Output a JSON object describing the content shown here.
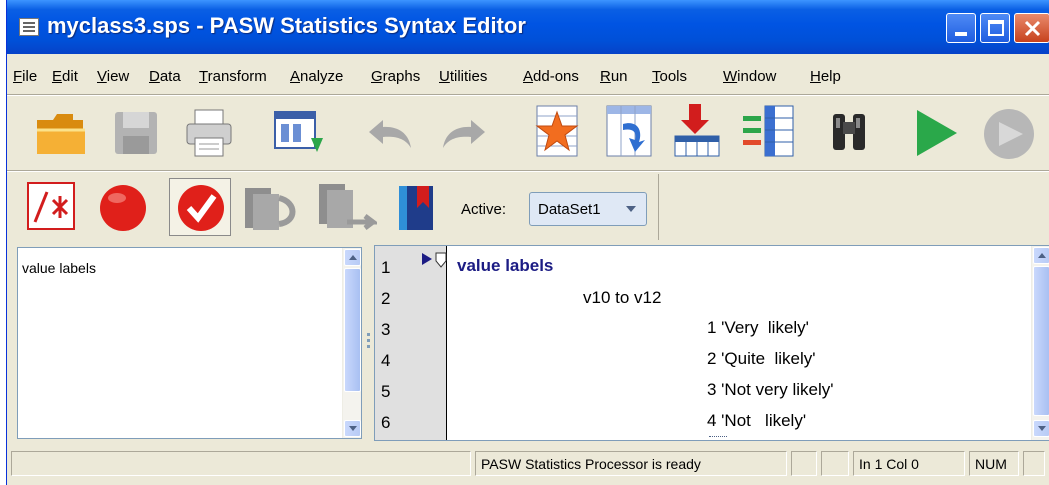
{
  "window": {
    "title": "myclass3.sps - PASW Statistics Syntax Editor"
  },
  "menu": [
    "File",
    "Edit",
    "View",
    "Data",
    "Transform",
    "Analyze",
    "Graphs",
    "Utilities",
    "Add-ons",
    "Run",
    "Tools",
    "Window",
    "Help"
  ],
  "toolbar_main": [
    "open-folder-icon",
    "save-disk-icon",
    "print-icon",
    "recall-dialog-icon",
    "undo-icon",
    "redo-icon",
    "goto-case-icon",
    "goto-variable-icon",
    "insert-cases-icon",
    "variables-icon",
    "find-binoculars-icon",
    "run-selection-icon",
    "stop-processor-icon"
  ],
  "toolbar_syntax": [
    "comment-icon",
    "breakpoint-icon",
    "validate-icon",
    "step-icon",
    "step-out-icon",
    "bookmark-icon"
  ],
  "active": {
    "label": "Active:",
    "value": "DataSet1"
  },
  "nav_pane": {
    "items": [
      "value labels"
    ]
  },
  "editor": {
    "line_numbers": [
      "1",
      "2",
      "3",
      "4",
      "5",
      "6"
    ],
    "lines": [
      "value labels",
      "v10 to v12",
      "1 'Very  likely'",
      "2 'Quite  likely'",
      "3 'Not very likely'",
      "4 'Not   likely'"
    ]
  },
  "status": {
    "processor": "PASW Statistics Processor is ready",
    "position": "In 1 Col 0",
    "num": "NUM"
  },
  "colors": {
    "titlebar": "#0054e3",
    "keyword": "#1c1c84",
    "gutter": "#e0e0e0",
    "run": "#2aa84a",
    "breakpoint": "#e0201a"
  }
}
